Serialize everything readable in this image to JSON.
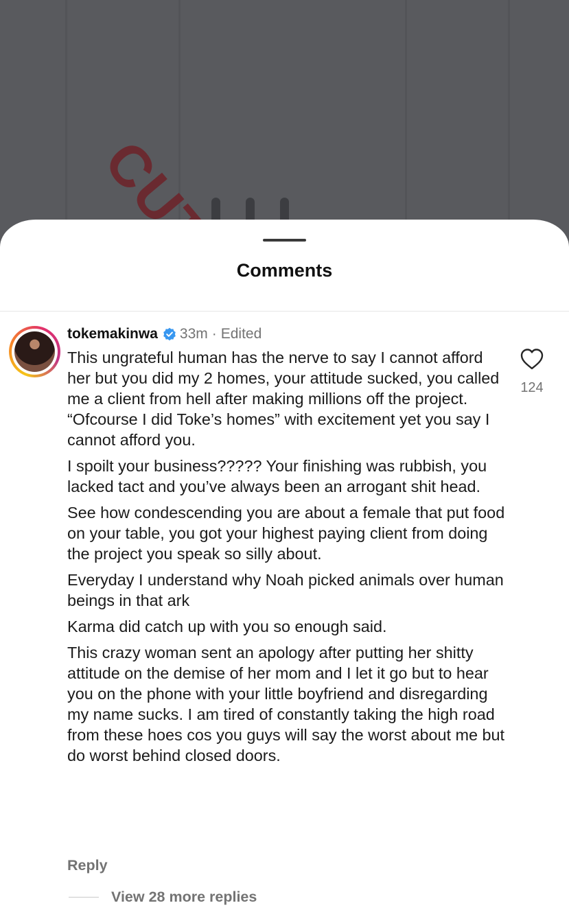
{
  "background": {
    "watermark_text": "CUTIE",
    "color": "#595a5e",
    "watermark_color": "#6a2a30"
  },
  "sheet": {
    "title": "Comments"
  },
  "comment": {
    "avatar": "avatar-image",
    "username": "tokemakinwa",
    "verified_icon": "verified-badge-icon",
    "time": "33m",
    "separator": "·",
    "edited": "Edited",
    "paragraphs": [
      "This ungrateful human has the nerve to say I cannot afford her but you did my 2 homes, your attitude sucked, you called me a client from hell after making millions off the project. “Ofcourse I did Toke’s homes” with excitement yet you say I cannot afford you.",
      "I spoilt your business????? Your finishing was rubbish, you lacked tact and you’ve always been an arrogant shit head.",
      "See how condescending you are about a female that put food on your table, you got your highest paying client from doing the project you speak so silly about.",
      "Everyday I understand why Noah picked animals over human beings in that ark",
      "Karma did catch up with you so enough said.",
      "This crazy woman sent an apology after putting her shitty attitude on the demise of her mom and I let it go but to hear you on the phone with your little boyfriend and disregarding my name sucks. I am tired of constantly taking the high road from these hoes cos you guys will say the worst about me but do worst behind closed doors."
    ],
    "like_icon": "heart-icon",
    "like_count": "124",
    "reply_label": "Reply",
    "more_replies_label": "View 28 more replies"
  },
  "colors": {
    "verified_blue": "#3897f0",
    "secondary_text": "#737373",
    "primary_text": "#1b1b1b"
  }
}
